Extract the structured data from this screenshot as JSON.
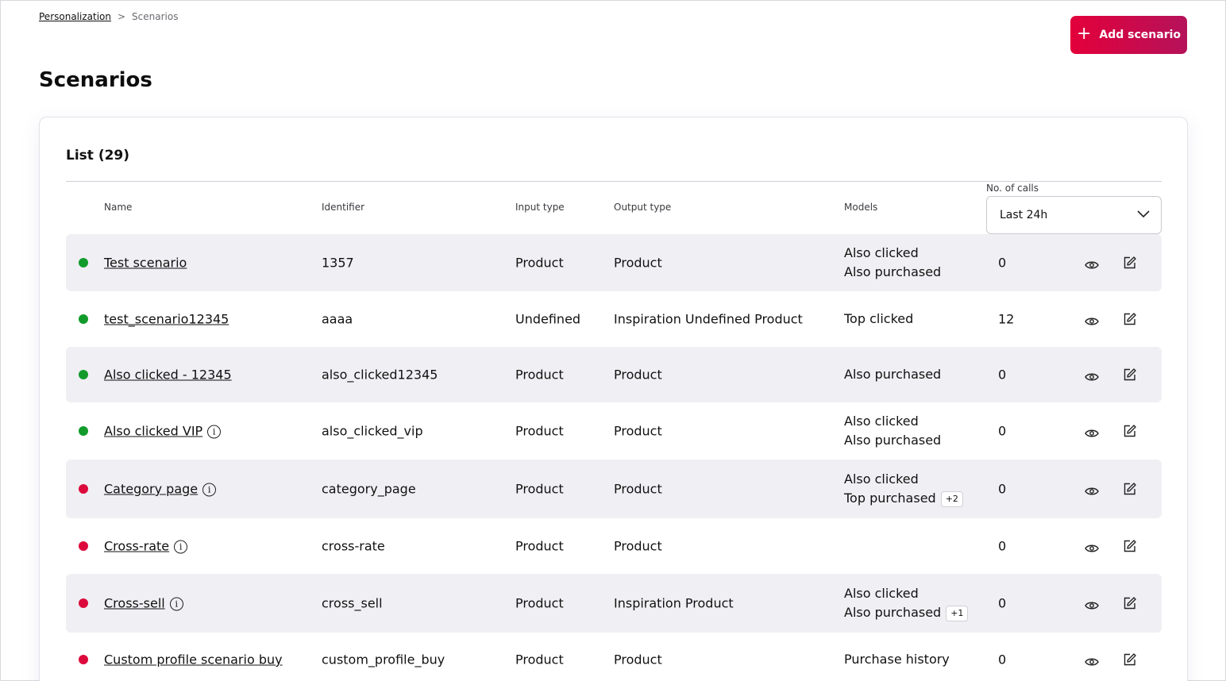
{
  "breadcrumb": {
    "parent": "Personalization",
    "separator": ">",
    "current": "Scenarios"
  },
  "add_button": {
    "icon": "plus-icon",
    "label": "Add scenario"
  },
  "page_title": "Scenarios",
  "list": {
    "title": "List (29)",
    "columns": {
      "name": "Name",
      "identifier": "Identifier",
      "input_type": "Input type",
      "output_type": "Output type",
      "models": "Models",
      "calls": "No. of calls"
    },
    "calls_filter": "Last 24h",
    "rows": [
      {
        "status": "active",
        "name": "Test scenario",
        "info": false,
        "identifier": "1357",
        "input_type": "Product",
        "output_type": "Product",
        "model_1": "Also clicked",
        "model_2": "Also purchased",
        "more": "",
        "calls": "0"
      },
      {
        "status": "active",
        "name": "test_scenario12345",
        "info": false,
        "identifier": "aaaa",
        "input_type": "Undefined",
        "output_type": "Inspiration Undefined Product",
        "model_1": "Top clicked",
        "model_2": "",
        "more": "",
        "calls": "12"
      },
      {
        "status": "active",
        "name": "Also clicked - 12345",
        "info": false,
        "identifier": "also_clicked12345",
        "input_type": "Product",
        "output_type": "Product",
        "model_1": "Also purchased",
        "model_2": "",
        "more": "",
        "calls": "0"
      },
      {
        "status": "active",
        "name": "Also clicked VIP",
        "info": true,
        "identifier": "also_clicked_vip",
        "input_type": "Product",
        "output_type": "Product",
        "model_1": "Also clicked",
        "model_2": "Also purchased",
        "more": "",
        "calls": "0"
      },
      {
        "status": "inactive",
        "name": "Category page",
        "info": true,
        "identifier": "category_page",
        "input_type": "Product",
        "output_type": "Product",
        "model_1": "Also clicked",
        "model_2": "Top purchased",
        "more": "+2",
        "calls": "0"
      },
      {
        "status": "inactive",
        "name": "Cross-rate",
        "info": true,
        "identifier": "cross-rate",
        "input_type": "Product",
        "output_type": "Product",
        "model_1": "",
        "model_2": "",
        "more": "",
        "calls": "0"
      },
      {
        "status": "inactive",
        "name": "Cross-sell",
        "info": true,
        "identifier": "cross_sell",
        "input_type": "Product",
        "output_type": "Inspiration Product",
        "model_1": "Also clicked",
        "model_2": "Also purchased",
        "more": "+1",
        "calls": "0"
      },
      {
        "status": "inactive",
        "name": "Custom profile scenario buy",
        "info": false,
        "identifier": "custom_profile_buy",
        "input_type": "Product",
        "output_type": "Product",
        "model_1": "Purchase history",
        "model_2": "",
        "more": "",
        "calls": "0"
      }
    ]
  },
  "info_glyph": "i",
  "colors": {
    "active": "#129b2a",
    "inactive": "#dc0a3c",
    "accent": "#e3003a",
    "row_alt": "#f0f0f4"
  },
  "row_icons": {
    "view": "eye-icon",
    "edit": "edit-icon",
    "info": "info-icon"
  }
}
